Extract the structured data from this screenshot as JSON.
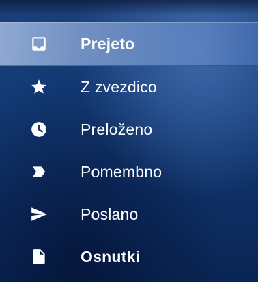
{
  "nav": {
    "items": [
      {
        "label": "Prejeto",
        "icon": "inbox-icon",
        "active": true,
        "bold": true
      },
      {
        "label": "Z zvezdico",
        "icon": "star-icon",
        "active": false,
        "bold": false
      },
      {
        "label": "Preloženo",
        "icon": "clock-icon",
        "active": false,
        "bold": false
      },
      {
        "label": "Pomembno",
        "icon": "label-icon",
        "active": false,
        "bold": false
      },
      {
        "label": "Poslano",
        "icon": "send-icon",
        "active": false,
        "bold": false
      },
      {
        "label": "Osnutki",
        "icon": "draft-icon",
        "active": false,
        "bold": true
      }
    ]
  },
  "colors": {
    "text": "#ffffff",
    "icon": "#ffffff",
    "active_highlight": "#a9c2ea",
    "background": "#133b77"
  }
}
